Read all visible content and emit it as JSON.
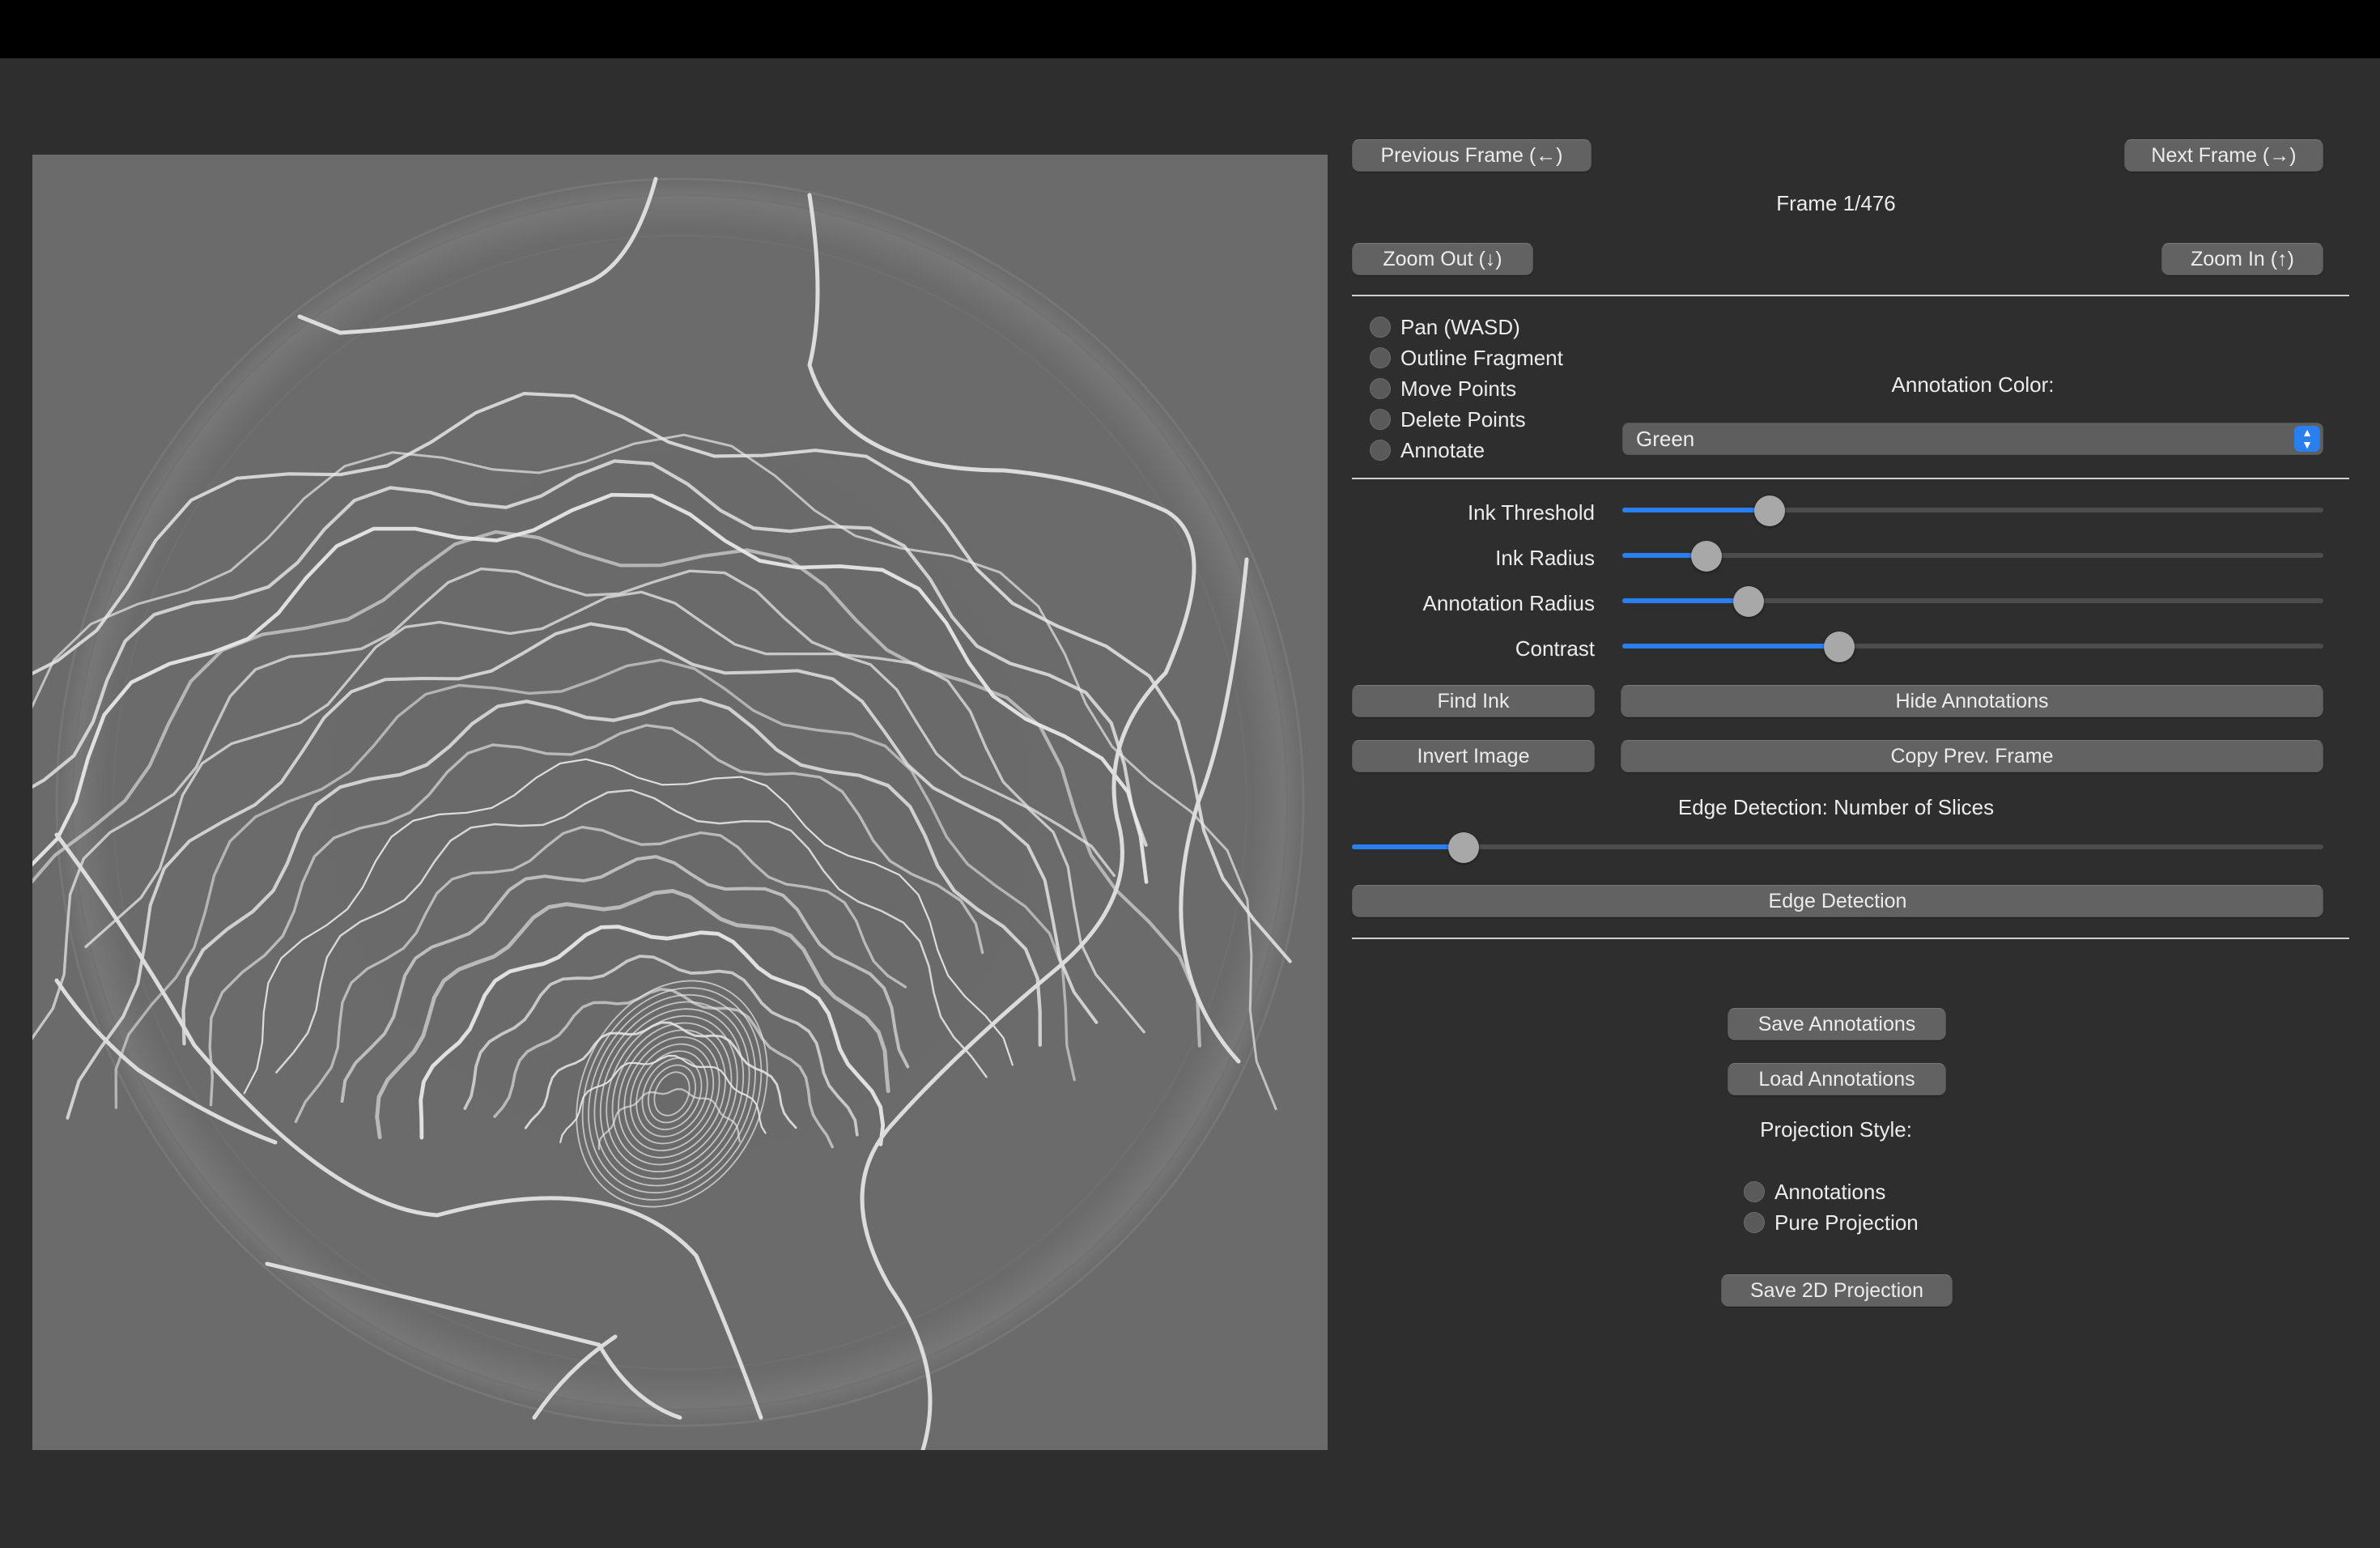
{
  "window": {
    "title": ""
  },
  "viewer": {
    "image_desc": "CT slice of scroll"
  },
  "nav": {
    "prev_label": "Previous Frame (←)",
    "next_label": "Next Frame (→)",
    "frame_label": "Frame 1/476",
    "zoom_out_label": "Zoom Out (↓)",
    "zoom_in_label": "Zoom In (↑)"
  },
  "tools": {
    "options": [
      {
        "label": "Pan (WASD)",
        "selected": true
      },
      {
        "label": "Outline Fragment",
        "selected": false
      },
      {
        "label": "Move Points",
        "selected": false
      },
      {
        "label": "Delete Points",
        "selected": false
      },
      {
        "label": "Annotate",
        "selected": false
      }
    ],
    "annotation_color_label": "Annotation Color:",
    "annotation_color_value": "Green"
  },
  "sliders": {
    "ink_threshold": {
      "label": "Ink Threshold",
      "fraction": 0.21
    },
    "ink_radius": {
      "label": "Ink Radius",
      "fraction": 0.12
    },
    "annotation_radius": {
      "label": "Annotation Radius",
      "fraction": 0.18
    },
    "contrast": {
      "label": "Contrast",
      "fraction": 0.31
    }
  },
  "actions": {
    "find_ink": "Find Ink",
    "hide_annotations": "Hide Annotations",
    "invert_image": "Invert Image",
    "copy_prev_frame": "Copy Prev. Frame"
  },
  "edge": {
    "label": "Edge Detection: Number of Slices",
    "fraction": 0.115,
    "button": "Edge Detection"
  },
  "files": {
    "save_annotations": "Save Annotations",
    "load_annotations": "Load Annotations",
    "projection_style_label": "Projection Style:",
    "projection_options": [
      {
        "label": "Annotations",
        "selected": true
      },
      {
        "label": "Pure Projection",
        "selected": false
      }
    ],
    "save_projection": "Save 2D Projection"
  },
  "colors": {
    "accent": "#2a7ff0",
    "background": "#2e2e2e",
    "viewer_bg": "#6b6b6b"
  }
}
